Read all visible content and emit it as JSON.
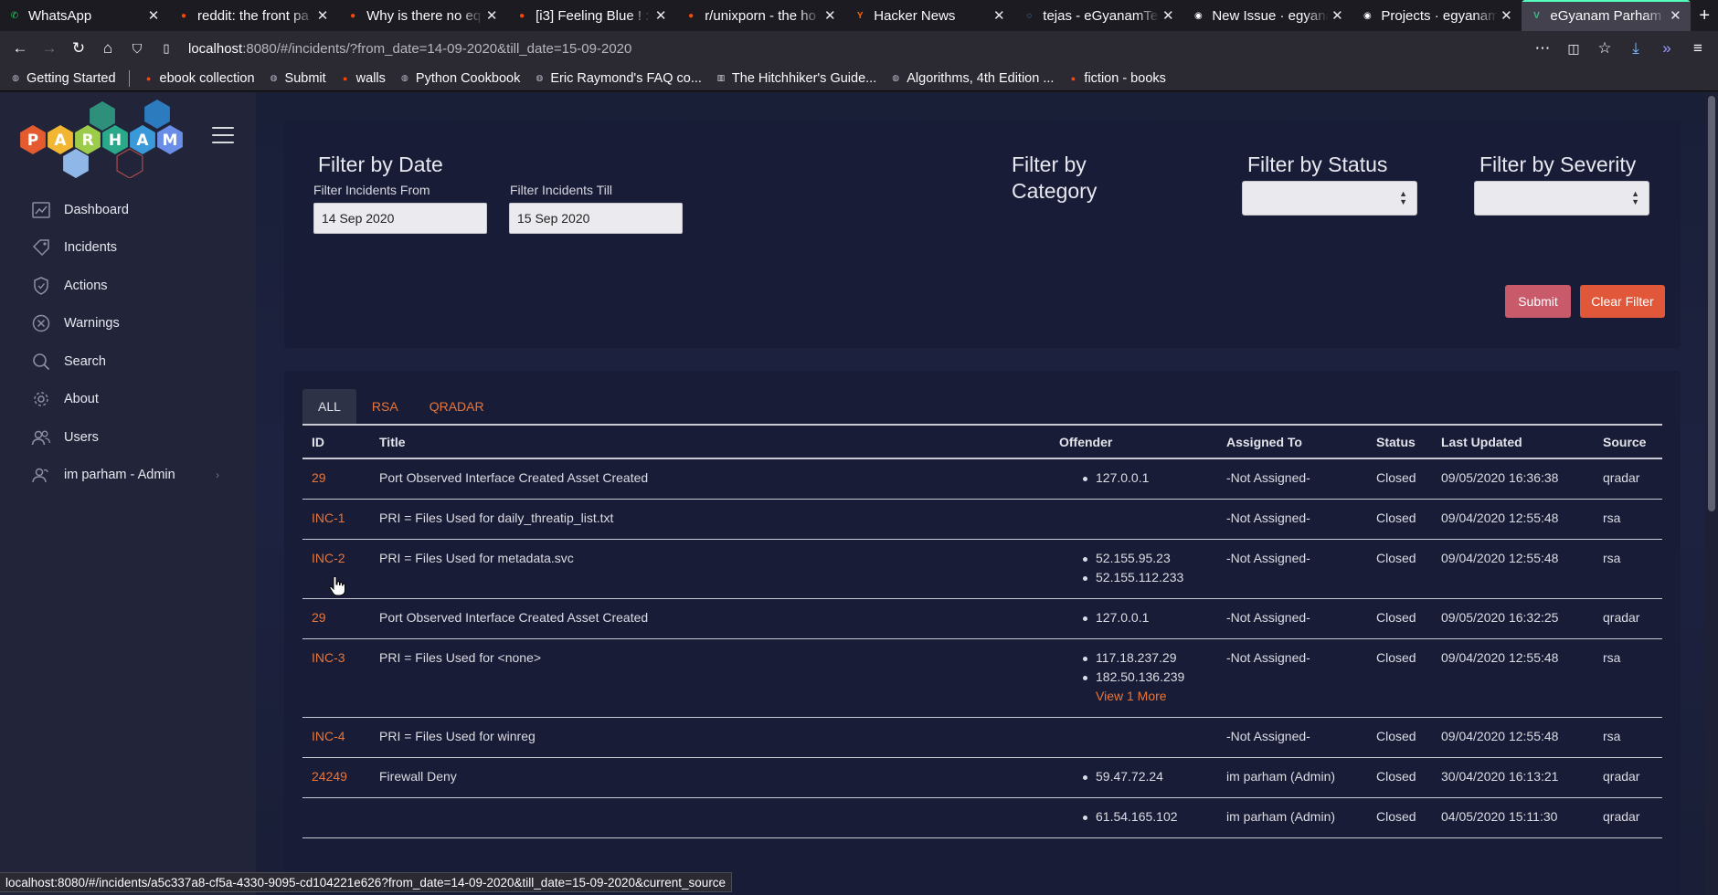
{
  "browser": {
    "tabs": [
      {
        "label": "WhatsApp",
        "icon": "whatsapp-icon",
        "color": "#25d366",
        "glyph": "✆",
        "active": false
      },
      {
        "label": "reddit: the front pa",
        "icon": "reddit-icon",
        "color": "#ff4500",
        "glyph": "●",
        "active": false
      },
      {
        "label": "Why is there no eq",
        "icon": "reddit-icon",
        "color": "#ff4500",
        "glyph": "●",
        "active": false
      },
      {
        "label": "[i3] Feeling Blue ! :",
        "icon": "reddit-icon",
        "color": "#ff4500",
        "glyph": "●",
        "active": false
      },
      {
        "label": "r/unixporn - the ho",
        "icon": "reddit-icon",
        "color": "#ff4500",
        "glyph": "●",
        "active": false
      },
      {
        "label": "Hacker News",
        "icon": "hackernews-icon",
        "color": "#ff6600",
        "glyph": "Y",
        "active": false
      },
      {
        "label": "tejas - eGyanamTe",
        "icon": "loading-icon",
        "color": "#7aa9ff",
        "glyph": "◌",
        "active": false
      },
      {
        "label": "New Issue · egyana",
        "icon": "github-icon",
        "color": "#ffffff",
        "glyph": "◉",
        "active": false
      },
      {
        "label": "Projects · egyanam",
        "icon": "github-icon",
        "color": "#ffffff",
        "glyph": "◉",
        "active": false
      },
      {
        "label": "eGyanam Parham",
        "icon": "vue-icon",
        "color": "#41b883",
        "glyph": "V",
        "active": true
      }
    ],
    "url_host": "localhost",
    "url_path": ":8080/#/incidents/?from_date=14-09-2020&till_date=15-09-2020",
    "bookmarks": [
      {
        "label": "Getting Started",
        "icon": "globe-icon"
      },
      {
        "label": "ebook collection",
        "icon": "reddit-icon"
      },
      {
        "label": "Submit",
        "icon": "globe-icon"
      },
      {
        "label": "walls",
        "icon": "reddit-icon"
      },
      {
        "label": "Python Cookbook",
        "icon": "globe-icon"
      },
      {
        "label": "Eric Raymond's FAQ co...",
        "icon": "globe-icon"
      },
      {
        "label": "The Hitchhiker's Guide...",
        "icon": "book-icon"
      },
      {
        "label": "Algorithms, 4th Edition ...",
        "icon": "globe-icon"
      },
      {
        "label": "fiction - books",
        "icon": "reddit-icon"
      }
    ],
    "status_url": "localhost:8080/#/incidents/a5c337a8-cf5a-4330-9095-cd104221e626?from_date=14-09-2020&till_date=15-09-2020&current_source"
  },
  "sidebar": {
    "logo_letters": [
      "P",
      "A",
      "R",
      "H",
      "A",
      "M"
    ],
    "items": [
      {
        "label": "Dashboard",
        "icon": "dashboard-icon"
      },
      {
        "label": "Incidents",
        "icon": "tag-icon"
      },
      {
        "label": "Actions",
        "icon": "shield-icon"
      },
      {
        "label": "Warnings",
        "icon": "x-circle-icon"
      },
      {
        "label": "Search",
        "icon": "search-icon"
      },
      {
        "label": "About",
        "icon": "gear-icon"
      },
      {
        "label": "Users",
        "icon": "users-icon"
      },
      {
        "label": "im parham - Admin",
        "icon": "user-icon",
        "has_chevron": true
      }
    ]
  },
  "filters": {
    "date_title": "Filter by Date",
    "from_label": "Filter Incidents From",
    "from_value": "14 Sep 2020",
    "till_label": "Filter Incidents Till",
    "till_value": "15 Sep 2020",
    "category_title": "Filter by Category",
    "status_title": "Filter by Status",
    "severity_title": "Filter by Severity",
    "submit_label": "Submit",
    "clear_label": "Clear Filter"
  },
  "source_tabs": [
    "ALL",
    "RSA",
    "QRADAR"
  ],
  "table": {
    "columns": [
      "ID",
      "Title",
      "Offender",
      "Assigned To",
      "Status",
      "Last Updated",
      "Source"
    ],
    "rows": [
      {
        "id": "29",
        "title": "Port Observed Interface Created Asset Created",
        "offenders": [
          "127.0.0.1"
        ],
        "more": "",
        "assigned": "-Not Assigned-",
        "status": "Closed",
        "updated": "09/05/2020 16:36:38",
        "source": "qradar"
      },
      {
        "id": "INC-1",
        "title": "PRI = Files Used for daily_threatip_list.txt",
        "offenders": [],
        "more": "",
        "assigned": "-Not Assigned-",
        "status": "Closed",
        "updated": "09/04/2020 12:55:48",
        "source": "rsa"
      },
      {
        "id": "INC-2",
        "title": "PRI = Files Used for metadata.svc",
        "offenders": [
          "52.155.95.23",
          "52.155.112.233"
        ],
        "more": "",
        "assigned": "-Not Assigned-",
        "status": "Closed",
        "updated": "09/04/2020 12:55:48",
        "source": "rsa"
      },
      {
        "id": "29",
        "title": "Port Observed Interface Created Asset Created",
        "offenders": [
          "127.0.0.1"
        ],
        "more": "",
        "assigned": "-Not Assigned-",
        "status": "Closed",
        "updated": "09/05/2020 16:32:25",
        "source": "qradar"
      },
      {
        "id": "INC-3",
        "title": "PRI = Files Used for <none>",
        "offenders": [
          "117.18.237.29",
          "182.50.136.239"
        ],
        "more": "View 1 More",
        "assigned": "-Not Assigned-",
        "status": "Closed",
        "updated": "09/04/2020 12:55:48",
        "source": "rsa"
      },
      {
        "id": "INC-4",
        "title": "PRI = Files Used for winreg",
        "offenders": [],
        "more": "",
        "assigned": "-Not Assigned-",
        "status": "Closed",
        "updated": "09/04/2020 12:55:48",
        "source": "rsa"
      },
      {
        "id": "24249",
        "title": "Firewall Deny",
        "offenders": [
          "59.47.72.24"
        ],
        "more": "",
        "assigned": "im parham (Admin)",
        "status": "Closed",
        "updated": "30/04/2020 16:13:21",
        "source": "qradar"
      },
      {
        "id": "",
        "title": "",
        "offenders": [
          "61.54.165.102"
        ],
        "more": "",
        "assigned": "im parham (Admin)",
        "status": "Closed",
        "updated": "04/05/2020 15:11:30",
        "source": "qradar"
      }
    ]
  },
  "colors": {
    "accent": "#e8763a",
    "submit": "#c85a6a",
    "clear": "#e0573a",
    "sidebar_bg": "#22253a",
    "card_bg": "#181c36"
  }
}
